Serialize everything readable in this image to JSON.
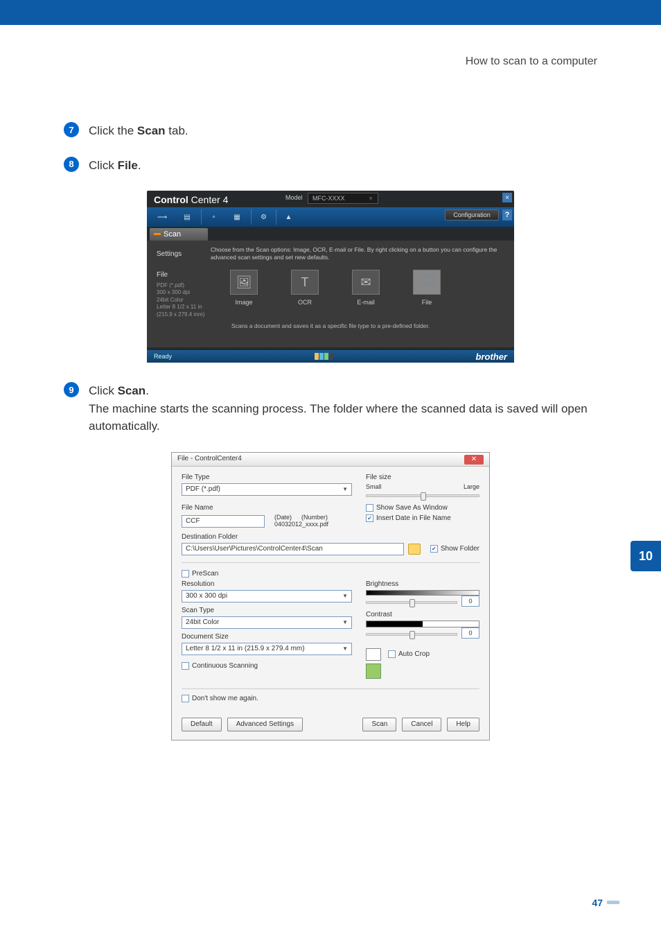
{
  "header": {
    "title": "How to scan to a computer"
  },
  "steps": {
    "s7": {
      "num": "7",
      "pre": "Click the ",
      "bold": "Scan",
      "post": " tab."
    },
    "s8": {
      "num": "8",
      "pre": "Click ",
      "bold": "File",
      "post": "."
    },
    "s9": {
      "num": "9",
      "pre": "Click ",
      "bold": "Scan",
      "post": ".",
      "body": "The machine starts the scanning process. The folder where the scanned data is saved will open automatically."
    }
  },
  "cc4": {
    "title_a": "Control",
    "title_b": "Center 4",
    "model_label": "Model",
    "model_value": "MFC-XXXX",
    "config": "Configuration",
    "scan_tab": "Scan",
    "settings_label": "Settings",
    "desc": "Choose from the Scan options: Image, OCR, E-mail or File. By right clicking on a button you can configure the advanced scan settings and set new defaults.",
    "file_label": "File",
    "file_info": "PDF (*.pdf)\n300 x 300 dpi\n24bit Color\nLetter 8 1/2 x 11 in\n(215.9 x 279.4 mm)",
    "opts": {
      "image": "Image",
      "ocr": "OCR",
      "email": "E-mail",
      "file": "File"
    },
    "footer_desc": "Scans a document and saves it as a specific file type to a pre-defined folder.",
    "status": "Ready",
    "brand": "brother"
  },
  "dlg": {
    "title": "File - ControlCenter4",
    "file_type_label": "File Type",
    "file_type": "PDF (*.pdf)",
    "file_size_label": "File size",
    "small": "Small",
    "large": "Large",
    "file_name_label": "File Name",
    "file_name": "CCF",
    "date_label": "(Date)",
    "number_label": "(Number)",
    "filename_preview": "04032012_xxxx.pdf",
    "show_saveas": "Show Save As Window",
    "insert_date": "Insert Date in File Name",
    "dest_label": "Destination Folder",
    "dest": "C:\\Users\\User\\Pictures\\ControlCenter4\\Scan",
    "show_folder": "Show Folder",
    "prescan": "PreScan",
    "resolution_label": "Resolution",
    "resolution": "300 x 300 dpi",
    "brightness_label": "Brightness",
    "brightness_val": "0",
    "scantype_label": "Scan Type",
    "scantype": "24bit Color",
    "contrast_label": "Contrast",
    "contrast_val": "0",
    "docsize_label": "Document Size",
    "docsize": "Letter 8 1/2 x 11 in (215.9 x 279.4 mm)",
    "continuous": "Continuous Scanning",
    "autocrop": "Auto Crop",
    "dontshow": "Don't show me again.",
    "btn_default": "Default",
    "btn_adv": "Advanced Settings",
    "btn_scan": "Scan",
    "btn_cancel": "Cancel",
    "btn_help": "Help"
  },
  "side": {
    "chapter": "10",
    "page": "47"
  }
}
